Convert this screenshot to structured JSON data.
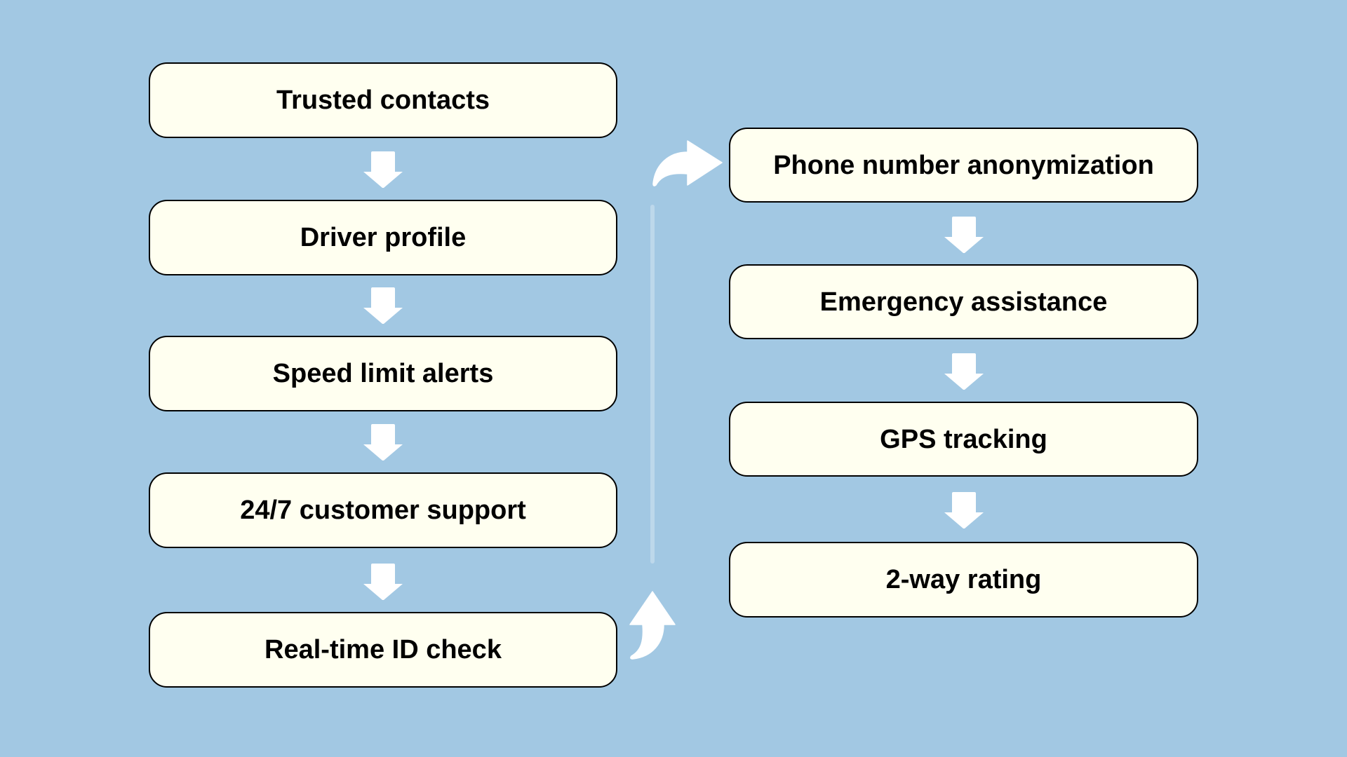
{
  "diagram": {
    "type": "flowchart",
    "background_color": "#A2C8E3",
    "box_fill_color": "#FFFFF0",
    "arrow_color": "#FFFFFF",
    "left_column": {
      "steps": [
        {
          "label": "Trusted contacts"
        },
        {
          "label": "Driver profile"
        },
        {
          "label": "Speed limit alerts"
        },
        {
          "label": "24/7 customer support"
        },
        {
          "label": "Real-time ID check"
        }
      ]
    },
    "right_column": {
      "steps": [
        {
          "label": "Phone number anonymization"
        },
        {
          "label": "Emergency assistance"
        },
        {
          "label": "GPS tracking"
        },
        {
          "label": "2-way rating"
        }
      ]
    },
    "connectors": [
      {
        "from": "Trusted contacts",
        "to": "Driver profile",
        "icon": "arrow-down-icon"
      },
      {
        "from": "Driver profile",
        "to": "Speed limit alerts",
        "icon": "arrow-down-icon"
      },
      {
        "from": "Speed limit alerts",
        "to": "24/7 customer support",
        "icon": "arrow-down-icon"
      },
      {
        "from": "24/7 customer support",
        "to": "Real-time ID check",
        "icon": "arrow-down-icon"
      },
      {
        "from": "Real-time ID check",
        "to": "Phone number anonymization",
        "icon": "curved-arrow-up-icon / curved-arrow-right-icon"
      },
      {
        "from": "Phone number anonymization",
        "to": "Emergency assistance",
        "icon": "arrow-down-icon"
      },
      {
        "from": "Emergency assistance",
        "to": "GPS tracking",
        "icon": "arrow-down-icon"
      },
      {
        "from": "GPS tracking",
        "to": "2-way rating",
        "icon": "arrow-down-icon"
      }
    ]
  }
}
